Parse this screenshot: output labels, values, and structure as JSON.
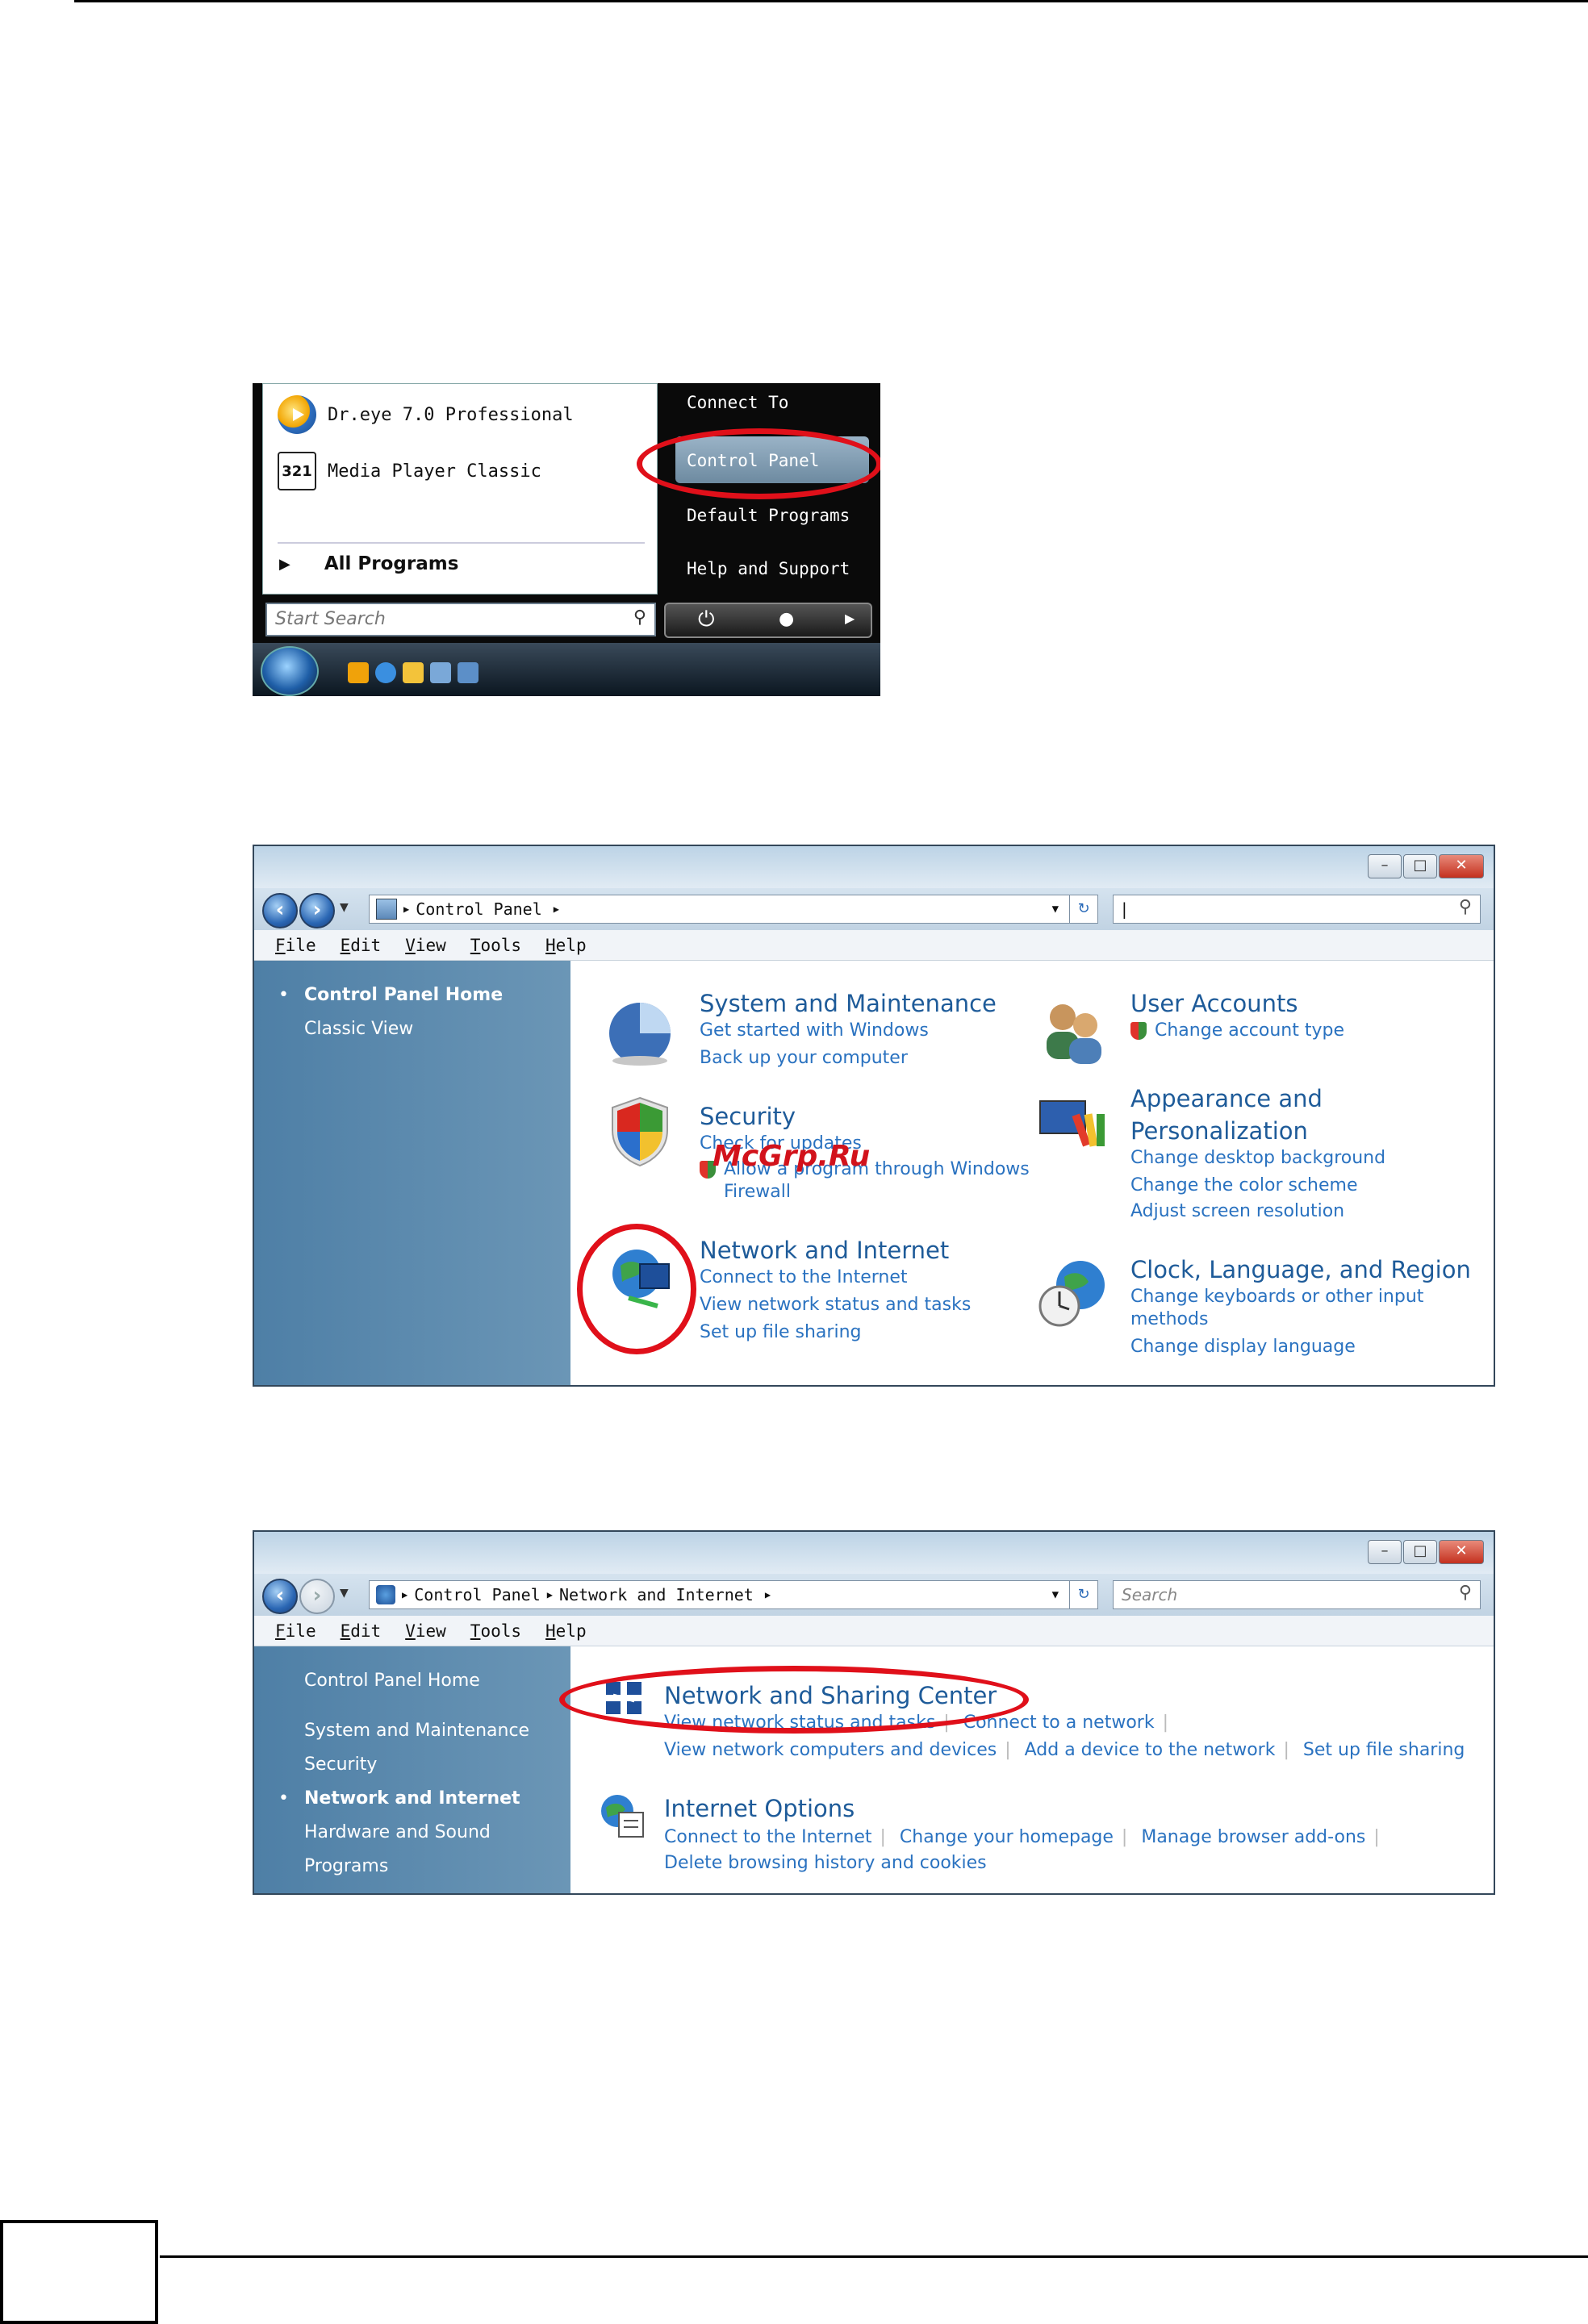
{
  "start_menu": {
    "programs": [
      {
        "label": "Dr.eye 7.0 Professional",
        "icon": "dreye-icon"
      },
      {
        "label": "Media Player Classic",
        "icon": "media-player-icon"
      }
    ],
    "all_programs": "All Programs",
    "search_placeholder": "Start Search",
    "right_items": [
      "Connect To",
      "Control Panel",
      "Default Programs",
      "Help and Support"
    ],
    "highlighted": "Control Panel"
  },
  "window1": {
    "address": "Control Panel",
    "search_value": "",
    "menu": [
      "File",
      "Edit",
      "View",
      "Tools",
      "Help"
    ],
    "sidebar": {
      "home": "Control Panel Home",
      "classic": "Classic View"
    },
    "categories": [
      {
        "title": "System and Maintenance",
        "links": [
          "Get started with Windows",
          "Back up your computer"
        ]
      },
      {
        "title": "User Accounts",
        "links": [
          "Change account type"
        ]
      },
      {
        "title": "Security",
        "links": [
          "Check for updates",
          "Allow a program through Windows",
          "Firewall"
        ]
      },
      {
        "title": "Appearance and",
        "title2": "Personalization",
        "links": [
          "Change desktop background",
          "Change the color scheme",
          "Adjust screen resolution"
        ]
      },
      {
        "title": "Network and Internet",
        "links": [
          "Connect to the Internet",
          "View network status and tasks",
          "Set up file sharing"
        ]
      },
      {
        "title": "Clock, Language, and Region",
        "links": [
          "Change keyboards or other input",
          "methods",
          "Change display language"
        ]
      }
    ],
    "watermark": "McGrp.Ru"
  },
  "window2": {
    "address": [
      "Control Panel",
      "Network and Internet"
    ],
    "search_placeholder": "Search",
    "menu": [
      "File",
      "Edit",
      "View",
      "Tools",
      "Help"
    ],
    "sidebar": [
      "Control Panel Home",
      "System and Maintenance",
      "Security",
      "Network and Internet",
      "Hardware and Sound",
      "Programs"
    ],
    "active_sidebar": "Network and Internet",
    "sections": [
      {
        "title": "Network and Sharing Center",
        "links": [
          "View network status and tasks",
          "Connect to a network",
          "View network computers and devices",
          "Add a device to the network",
          "Set up file sharing"
        ]
      },
      {
        "title": "Internet Options",
        "links": [
          "Connect to the Internet",
          "Change your homepage",
          "Manage browser add-ons",
          "Delete browsing history and cookies"
        ]
      }
    ]
  },
  "colors": {
    "link": "#2a72c0",
    "title": "#1e5b99",
    "highlight_oval": "#e0101a",
    "sidebar": "#5a87ac"
  }
}
